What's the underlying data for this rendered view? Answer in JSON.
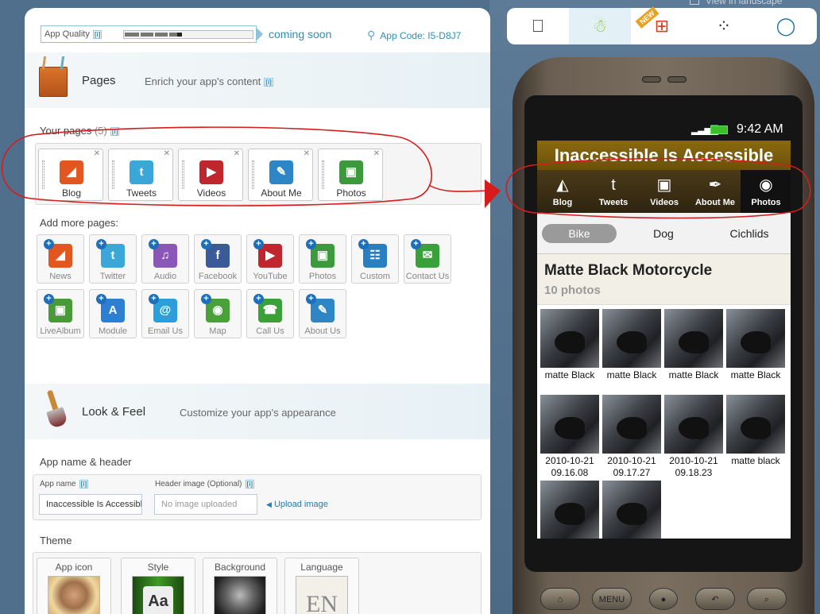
{
  "header": {
    "app_quality_label": "App Quality",
    "app_quality_info": "[i]",
    "app_quality_progress": 0.45,
    "coming_soon": "coming soon",
    "app_code_label": "App Code: I5-D8J7"
  },
  "landscape_link": "View in landscape",
  "pages_section": {
    "title": "Pages",
    "subtitle": "Enrich your app's content",
    "info": "[i]",
    "your_pages_label": "Your pages",
    "your_pages_count": "(5)",
    "your_pages": [
      {
        "label": "Blog",
        "icon": "rss-icon",
        "color": "#e2561f",
        "glyph": "◢"
      },
      {
        "label": "Tweets",
        "icon": "twitter-icon",
        "color": "#3aa7d8",
        "glyph": "t"
      },
      {
        "label": "Videos",
        "icon": "youtube-icon",
        "color": "#c0262e",
        "glyph": "▶"
      },
      {
        "label": "About Me",
        "icon": "notepad-icon",
        "color": "#2f86c6",
        "glyph": "✎"
      },
      {
        "label": "Photos",
        "icon": "photo-icon",
        "color": "#3c9a3c",
        "glyph": "▣"
      }
    ],
    "add_more_label": "Add more pages:",
    "add_pages_row1": [
      {
        "label": "News",
        "icon": "rss-icon",
        "color": "#e2561f",
        "glyph": "◢"
      },
      {
        "label": "Twitter",
        "icon": "twitter-icon",
        "color": "#3aa7d8",
        "glyph": "t"
      },
      {
        "label": "Audio",
        "icon": "audio-icon",
        "color": "#8a56b8",
        "glyph": "♫"
      },
      {
        "label": "Facebook",
        "icon": "facebook-icon",
        "color": "#3b5a98",
        "glyph": "f"
      },
      {
        "label": "YouTube",
        "icon": "youtube-icon",
        "color": "#c0262e",
        "glyph": "▶"
      },
      {
        "label": "Photos",
        "icon": "photo-icon",
        "color": "#3c9a3c",
        "glyph": "▣"
      },
      {
        "label": "Custom",
        "icon": "custom-icon",
        "color": "#2a7fc0",
        "glyph": "☷"
      },
      {
        "label": "Contact Us",
        "icon": "contact-icon",
        "color": "#3aa13a",
        "glyph": "✉"
      }
    ],
    "add_pages_row2": [
      {
        "label": "LiveAlbum",
        "icon": "live-album-icon",
        "color": "#4a9a3a",
        "glyph": "▣"
      },
      {
        "label": "Module",
        "icon": "module-icon",
        "color": "#2f7fd0",
        "glyph": "A"
      },
      {
        "label": "Email Us",
        "icon": "email-icon",
        "color": "#2a9fd8",
        "glyph": "@"
      },
      {
        "label": "Map",
        "icon": "map-pin-icon",
        "color": "#4aa03a",
        "glyph": "◉"
      },
      {
        "label": "Call Us",
        "icon": "phone-icon",
        "color": "#3aa13a",
        "glyph": "☎"
      },
      {
        "label": "About Us",
        "icon": "notepad-icon",
        "color": "#2f86c6",
        "glyph": "✎"
      }
    ]
  },
  "look_section": {
    "title": "Look & Feel",
    "subtitle": "Customize your app's appearance",
    "app_name_header_label": "App name & header",
    "app_name_label": "App name",
    "app_name_info": "[i]",
    "app_name_value": "Inaccessible Is Accessible",
    "header_image_label": "Header image (Optional)",
    "header_image_info": "[i]",
    "header_image_placeholder": "No image uploaded",
    "upload_link": "Upload image",
    "theme_label": "Theme",
    "theme_cards": [
      {
        "label": "App icon"
      },
      {
        "label": "Style",
        "preview_text": "Aa"
      },
      {
        "label": "Background"
      },
      {
        "label": "Language",
        "preview_text": "EN"
      }
    ]
  },
  "os_tabs": [
    {
      "name": "apple-icon",
      "glyph": "",
      "selected": false
    },
    {
      "name": "android-icon",
      "glyph": "☃",
      "selected": true
    },
    {
      "name": "windows-phone-icon",
      "glyph": "⊞",
      "selected": false,
      "badge": "NEW"
    },
    {
      "name": "blackberry-icon",
      "glyph": "⁘",
      "selected": false
    },
    {
      "name": "opera-icon",
      "glyph": "◯",
      "selected": false
    }
  ],
  "phone": {
    "time": "9:42 AM",
    "app_title": "Inaccessible Is Accessible",
    "tabs": [
      {
        "label": "Blog",
        "icon": "laptop-icon",
        "glyph": "◭",
        "selected": false
      },
      {
        "label": "Tweets",
        "icon": "twitter-icon",
        "glyph": "t",
        "selected": false
      },
      {
        "label": "Videos",
        "icon": "video-camera-icon",
        "glyph": "▣",
        "selected": false
      },
      {
        "label": "About Me",
        "icon": "feather-icon",
        "glyph": "✒",
        "selected": false
      },
      {
        "label": "Photos",
        "icon": "camera-icon",
        "glyph": "◉",
        "selected": true
      }
    ],
    "segments": [
      {
        "label": "Bike",
        "selected": true
      },
      {
        "label": "Dog",
        "selected": false
      },
      {
        "label": "Cichlids",
        "selected": false
      }
    ],
    "album_title": "Matte Black Motorcycle",
    "album_count": "10 photos",
    "photos_row1": [
      "matte Black",
      "matte Black",
      "matte Black",
      "matte Black"
    ],
    "photos_row2": [
      "2010-10-21 09.16.08",
      "2010-10-21 09.17.27",
      "2010-10-21 09.18.23",
      "matte black"
    ],
    "photos_row3_count": 2,
    "hardware_buttons": [
      {
        "name": "home-button",
        "label": "⌂"
      },
      {
        "name": "menu-button",
        "label": "MENU"
      },
      {
        "name": "trackball",
        "label": "●"
      },
      {
        "name": "back-button",
        "label": "↶"
      },
      {
        "name": "search-button",
        "label": "⌕"
      }
    ]
  }
}
